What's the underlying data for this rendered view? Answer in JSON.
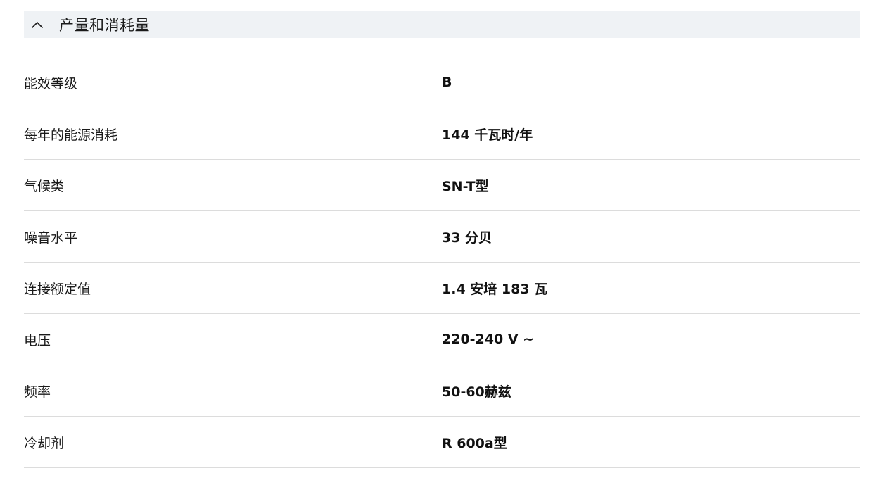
{
  "section": {
    "title": "产量和消耗量",
    "toggle_icon": "chevron-up-icon"
  },
  "specs": [
    {
      "label": "能效等级",
      "value": "B"
    },
    {
      "label": "每年的能源消耗",
      "value": "144 千瓦时/年"
    },
    {
      "label": "气候类",
      "value": "SN-T型"
    },
    {
      "label": "噪音水平",
      "value": "33 分贝"
    },
    {
      "label": "连接额定值",
      "value": "1.4 安培 183 瓦"
    },
    {
      "label": "电压",
      "value": "220-240 V ~"
    },
    {
      "label": "频率",
      "value": "50-60赫兹"
    },
    {
      "label": "冷却剂",
      "value": "R 600a型"
    }
  ]
}
